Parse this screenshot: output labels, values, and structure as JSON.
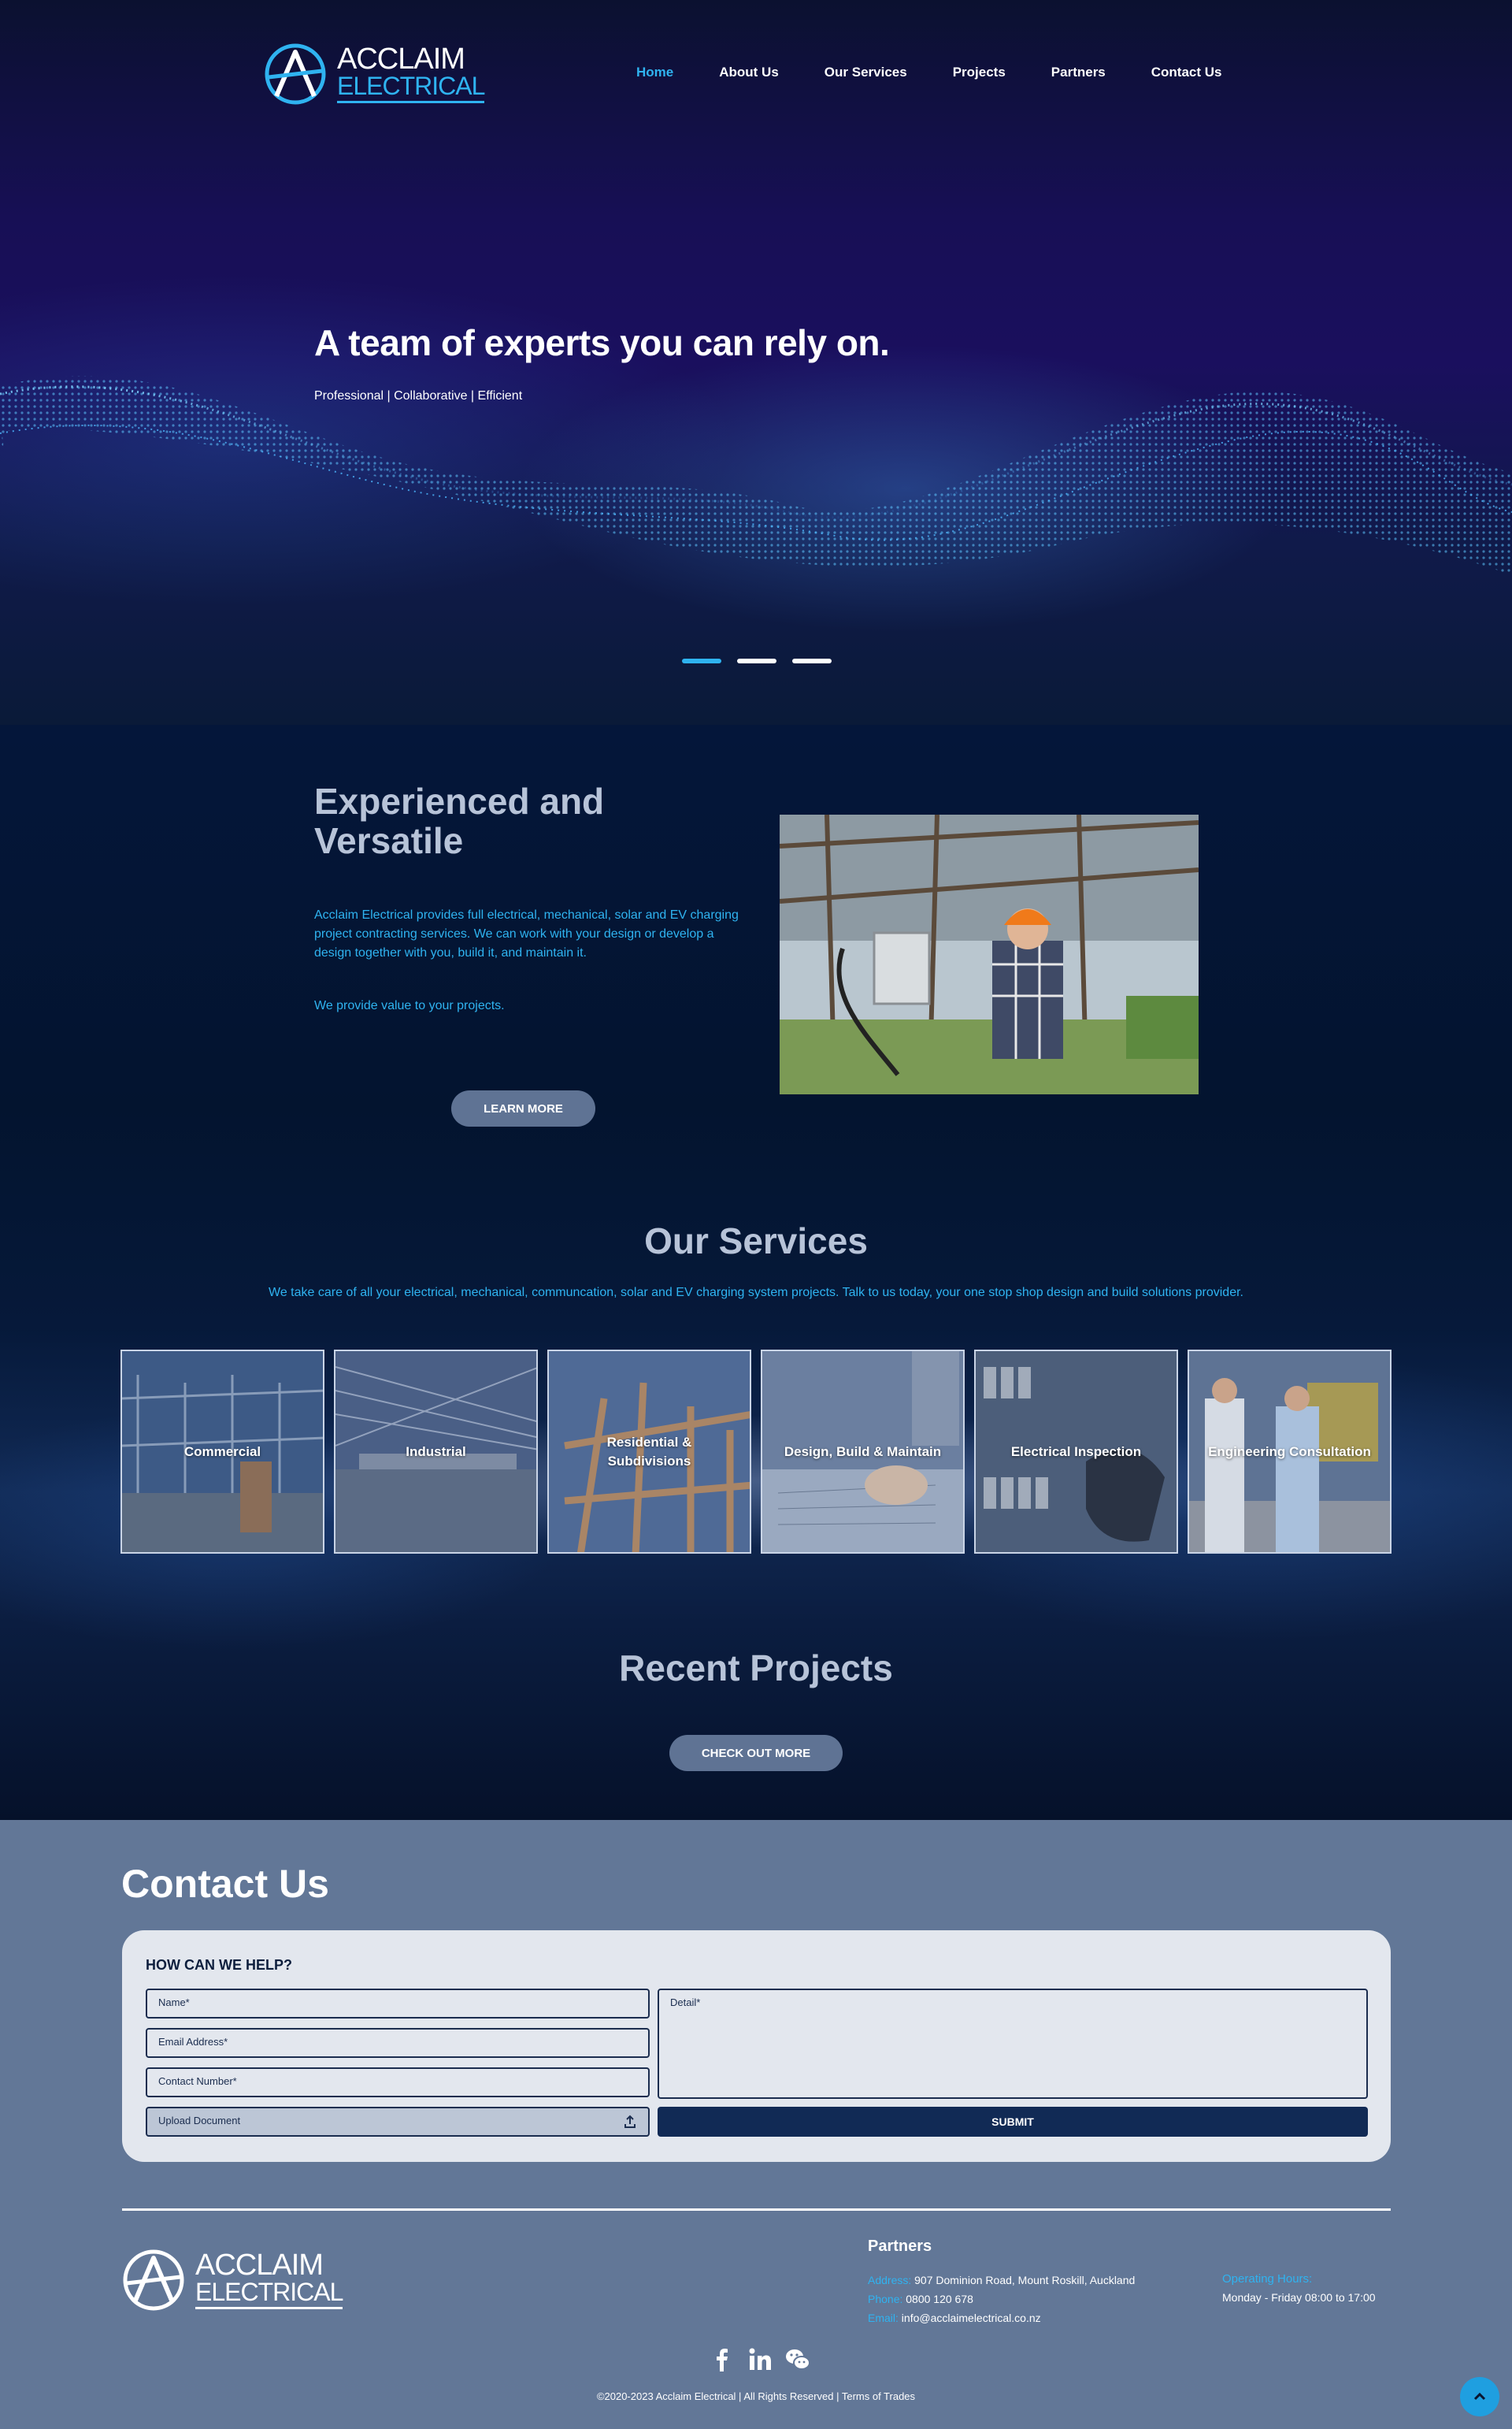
{
  "brand": {
    "line1": "ACCLAIM",
    "line2": "ELECTRICAL",
    "accent": "#2fb3f0"
  },
  "nav": [
    {
      "label": "Home",
      "active": true
    },
    {
      "label": "About Us",
      "active": false
    },
    {
      "label": "Our Services",
      "active": false
    },
    {
      "label": "Projects",
      "active": false
    },
    {
      "label": "Partners",
      "active": false
    },
    {
      "label": "Contact Us",
      "active": false
    }
  ],
  "hero": {
    "title": "A team of experts you can rely on.",
    "subtitle": "Professional | Collaborative | Efficient",
    "slides": 3,
    "active_slide": 1
  },
  "intro": {
    "title": "Experienced and Versatile",
    "paragraph1": "Acclaim Electrical provides full electrical, mechanical, solar and EV charging project contracting services. We can work with your design or develop a design together with you, build it, and maintain it.",
    "paragraph2": "We provide value to your projects.",
    "button": "LEARN MORE"
  },
  "services": {
    "title": "Our Services",
    "subtitle": "We take care of all your electrical, mechanical, communcation, solar and EV charging system projects. Talk to us today, your one stop shop design and build solutions provider.",
    "items": [
      {
        "label": "Commercial",
        "color": "#3d5a86"
      },
      {
        "label": "Industrial",
        "color": "#4a5f86"
      },
      {
        "label": "Residential & Subdivisions",
        "color": "#5a6f8e"
      },
      {
        "label": "Design, Build & Maintain",
        "color": "#6b7fa0"
      },
      {
        "label": "Electrical Inspection",
        "color": "#4c5e7a"
      },
      {
        "label": "Engineering Consultation",
        "color": "#5e7394"
      }
    ]
  },
  "projects": {
    "title": "Recent Projects",
    "button": "CHECK OUT MORE"
  },
  "contact": {
    "title": "Contact Us",
    "form_heading": "HOW CAN WE HELP?",
    "name_placeholder": "Name*",
    "email_placeholder": "Email Address*",
    "phone_placeholder": "Contact Number*",
    "upload_label": "Upload Document",
    "detail_placeholder": "Detail*",
    "submit": "SUBMIT"
  },
  "footer": {
    "partners": "Partners",
    "address_label": "Address:",
    "address": "907 Dominion Road, Mount Roskill, Auckland",
    "phone_label": "Phone:",
    "phone": "0800 120 678",
    "email_label": "Email:",
    "email": "info@acclaimelectrical.co.nz",
    "hours_label": "Operating Hours:",
    "hours": "Monday - Friday 08:00 to 17:00",
    "social": [
      "facebook-icon",
      "linkedin-icon",
      "wechat-icon"
    ],
    "copyright": "©2020-2023 Acclaim Electrical | All Rights Reserved | Terms of Trades"
  }
}
